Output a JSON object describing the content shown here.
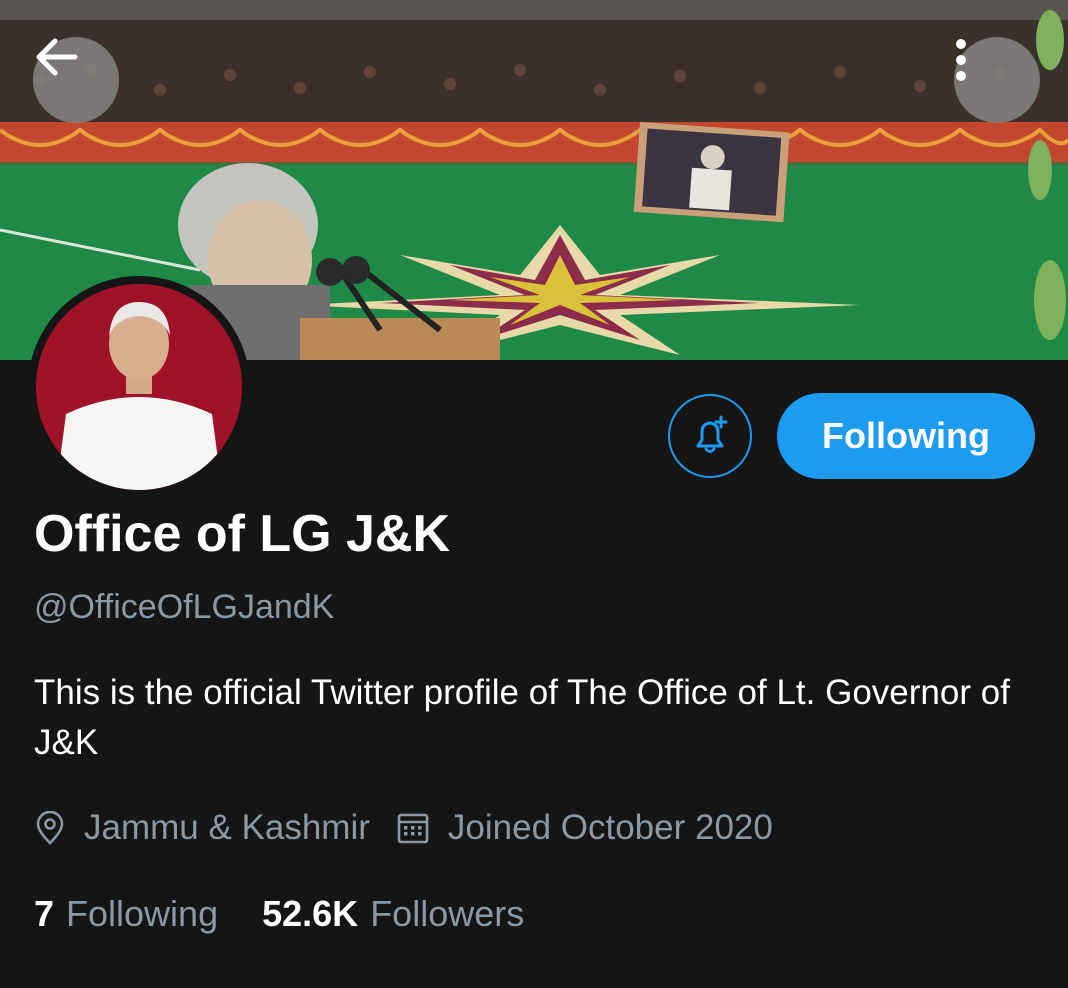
{
  "header": {
    "back_icon": "arrow-left-icon",
    "more_icon": "more-vertical-icon"
  },
  "profile": {
    "display_name": "Office of LG J&K",
    "handle": "@OfficeOfLGJandK",
    "bio": "This is the official Twitter profile of The Office of Lt. Governor of J&K",
    "location": "Jammu & Kashmir",
    "joined": "Joined October 2020",
    "following_count": "7",
    "following_label": "Following",
    "followers_count": "52.6K",
    "followers_label": "Followers"
  },
  "actions": {
    "notify_icon": "bell-plus-icon",
    "follow_state_label": "Following"
  },
  "colors": {
    "background": "#151515",
    "accent": "#1d9bf0",
    "secondary_text": "#8b98a5",
    "avatar_bg": "#a01227"
  }
}
